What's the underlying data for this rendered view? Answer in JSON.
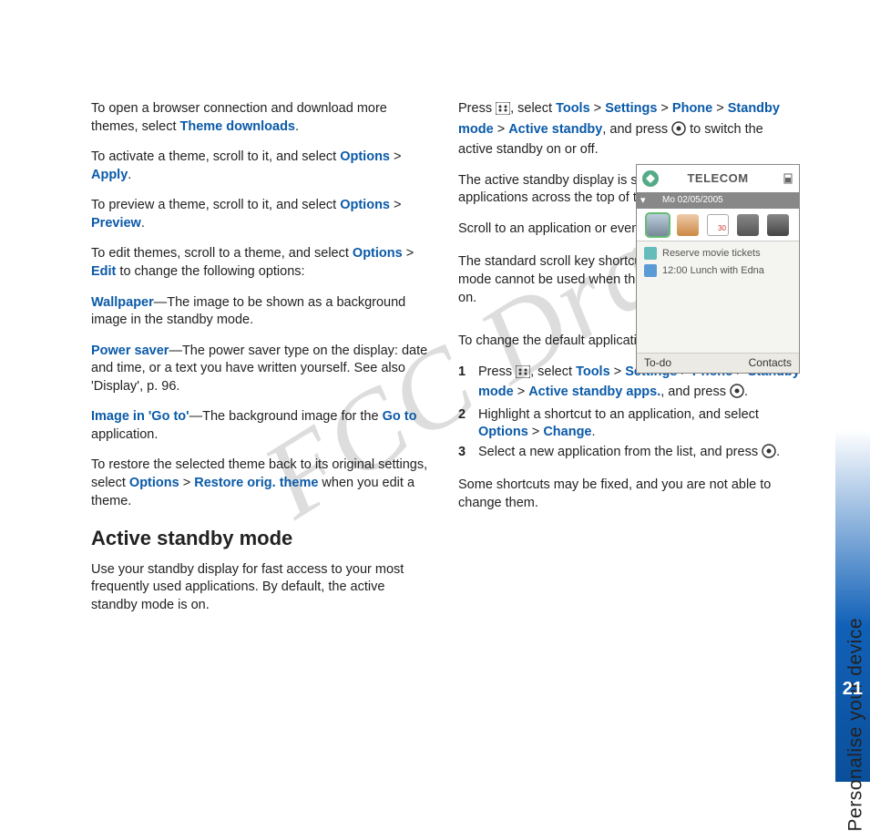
{
  "sidebar": {
    "title": "Personalise your device",
    "page_number": "21"
  },
  "watermark": "FCC Draft",
  "left": {
    "p1a": "To open a browser connection and download more themes, select ",
    "p1_link": "Theme downloads",
    "p1b": ".",
    "p2a": "To activate a theme, scroll to it, and select ",
    "p2_opt": "Options",
    "p2_gt": " > ",
    "p2_apply": "Apply",
    "p2b": ".",
    "p3a": "To preview a theme, scroll to it, and select ",
    "p3_opt": "Options",
    "p3_gt": " > ",
    "p3_prev": "Preview",
    "p3b": ".",
    "p4a": "To edit themes, scroll to a theme, and select ",
    "p4_opt": "Options",
    "p4_gt": " > ",
    "p4_edit": "Edit",
    "p4b": " to change the following options:",
    "p5_lbl": "Wallpaper",
    "p5_body": "—The image to be shown as a background image in the standby mode.",
    "p6_lbl": "Power saver",
    "p6_body": "—The power saver type on the display: date and time, or a text you have written yourself. See also 'Display', p. 96.",
    "p7_lbl": "Image in 'Go to'",
    "p7_body_a": "—The background image for the ",
    "p7_goto": "Go to",
    "p7_body_b": " application.",
    "p8a": "To restore the selected theme back to its original settings, select ",
    "p8_opt": "Options",
    "p8_gt": " > ",
    "p8_restore": "Restore orig. theme",
    "p8b": " when you edit a theme.",
    "h2": "Active standby mode",
    "p9": "Use your standby display for fast access to your most frequently used applications. By default, the active standby mode is on."
  },
  "right": {
    "p1a": "Press ",
    "p1b": ", select ",
    "p1_tools": "Tools",
    "p1_gt1": " > ",
    "p1_settings": "Settings",
    "p1_gt2": " > ",
    "p1_phone": "Phone",
    "p1_gt3": " > ",
    "p1_standby": "Standby mode",
    "p1_gt4": " > ",
    "p1_active": "Active standby",
    "p1c": ", and press ",
    "p1d": " to switch the active standby on or off.",
    "p2": "The active standby display is shown with default applications across the top of the screen.",
    "p3a": "Scroll to an application or event, and press ",
    "p3b": ".",
    "p4": "The standard scroll key shortcuts available in the standby mode cannot be used when the active standby mode is on.",
    "p5": "To change the default applications shortcuts:",
    "step1_a": "Press ",
    "step1_b": ", select ",
    "step1_tools": "Tools",
    "step1_gt1": " > ",
    "step1_settings": "Settings",
    "step1_gt2": " > ",
    "step1_phone": "Phone",
    "step1_gt3": " > ",
    "step1_standby": "Standby mode",
    "step1_gt4": " > ",
    "step1_apps": "Active standby apps.",
    "step1_c": ", and press ",
    "step1_d": ".",
    "step2_a": "Highlight a shortcut to an application, and select ",
    "step2_opt": "Options",
    "step2_gt": " > ",
    "step2_change": "Change",
    "step2_b": ".",
    "step3_a": "Select a new application from the list, and press ",
    "step3_b": ".",
    "p6": "Some shortcuts may be fixed, and you are not able to change them.",
    "nums": {
      "n1": "1",
      "n2": "2",
      "n3": "3"
    }
  },
  "phone": {
    "operator": "TELECOM",
    "date": "Mo 02/05/2005",
    "item1": "Reserve movie tickets",
    "item2": "12:00 Lunch with Edna",
    "soft_left": "To-do",
    "soft_right": "Contacts",
    "colors": {
      "item1_icon": "#6bb",
      "item2_icon": "#5b9bd5"
    }
  }
}
